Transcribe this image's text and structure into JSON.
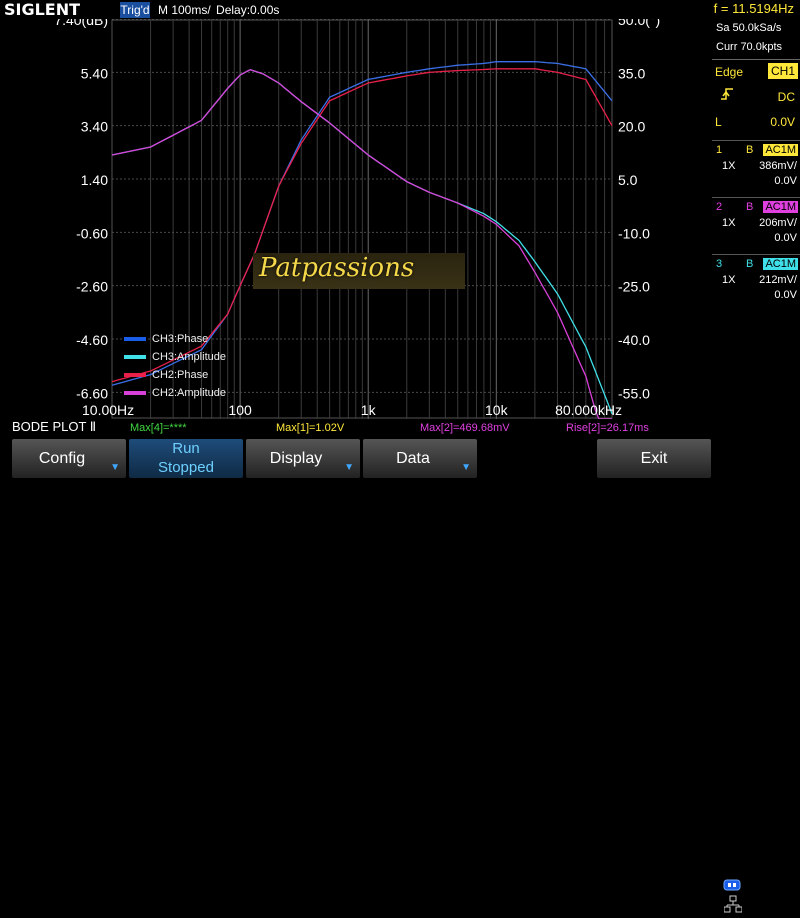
{
  "header": {
    "logo": "SIGLENT",
    "trigger_status": "Trig'd",
    "timebase": "M 100ms/",
    "delay": "Delay:0.00s",
    "frequency": "f = 11.5194Hz"
  },
  "side_panel": {
    "sample_rate": "Sa 50.0kSa/s",
    "memory": "Curr 70.0kpts",
    "trigger_type": "Edge",
    "trigger_source": "CH1",
    "coupling": "DC",
    "level_label": "L",
    "level_value": "0.0V",
    "channels": [
      {
        "num": "1",
        "bw": "B",
        "coupling": "AC1M",
        "probe": "1X",
        "scale": "386mV/",
        "offset": "0.0V",
        "color": "#ffe83a"
      },
      {
        "num": "2",
        "bw": "B",
        "coupling": "AC1M",
        "probe": "1X",
        "scale": "206mV/",
        "offset": "0.0V",
        "color": "#e040e0"
      },
      {
        "num": "3",
        "bw": "B",
        "coupling": "AC1M",
        "probe": "1X",
        "scale": "212mV/",
        "offset": "0.0V",
        "color": "#40e0e8"
      }
    ]
  },
  "status_bar": {
    "mode": "BODE PLOT Ⅱ",
    "meas4": "Max[4]=****",
    "meas1": "Max[1]=1.02V",
    "meas2": "Max[2]=469.68mV",
    "rise2": "Rise[2]=26.17ms"
  },
  "softkeys": {
    "config": "Config",
    "run_line1": "Run",
    "run_line2": "Stopped",
    "display": "Display",
    "data": "Data",
    "exit": "Exit"
  },
  "watermark": "Patpassions",
  "colors": {
    "ch3_phase": "#3a6fe8",
    "ch3_amplitude": "#40e0e8",
    "ch2_phase": "#e8204a",
    "ch2_amplitude": "#d840d8"
  },
  "chart_data": {
    "type": "line",
    "title": "",
    "x_scale": "log",
    "xlim": [
      10,
      80000
    ],
    "x_ticks": [
      "10.00Hz",
      "100",
      "1k",
      "10k",
      "80.000kHz"
    ],
    "left_axis": {
      "label": "(dB)",
      "ylim": [
        -7.6,
        7.4
      ],
      "ticks": [
        "7.40(dB)",
        "5.40",
        "3.40",
        "1.40",
        "-0.60",
        "-2.60",
        "-4.60",
        "-6.60"
      ]
    },
    "right_axis": {
      "label": "(°)",
      "ylim": [
        -62.5,
        50
      ],
      "ticks": [
        "50.0(°)",
        "35.0",
        "20.0",
        "5.0",
        "-10.0",
        "-25.0",
        "-40.0",
        "-55.0"
      ]
    },
    "series": [
      {
        "name": "CH3:Phase",
        "axis": "right",
        "x": [
          10,
          20,
          50,
          80,
          100,
          130,
          200,
          300,
          500,
          1000,
          2000,
          3000,
          5000,
          8000,
          10000,
          15000,
          20000,
          30000,
          50000,
          80000
        ],
        "y": [
          -53,
          -50,
          -43,
          -33,
          -25,
          -16,
          3,
          16,
          28,
          33,
          35,
          36,
          37,
          37.5,
          38,
          38,
          38,
          37.5,
          36,
          27
        ]
      },
      {
        "name": "CH3:Amplitude",
        "axis": "left",
        "x": [
          10,
          20,
          50,
          80,
          100,
          120,
          150,
          200,
          300,
          500,
          1000,
          2000,
          3000,
          5000,
          8000,
          10000,
          15000,
          20000,
          30000,
          50000,
          80000
        ],
        "y": [
          2.3,
          2.6,
          3.6,
          4.8,
          5.3,
          5.5,
          5.35,
          5.0,
          4.3,
          3.5,
          2.3,
          1.3,
          0.9,
          0.5,
          0.1,
          -0.2,
          -0.9,
          -1.7,
          -2.9,
          -4.9,
          -7.4
        ]
      },
      {
        "name": "CH2:Phase",
        "axis": "right",
        "x": [
          10,
          20,
          50,
          80,
          100,
          130,
          200,
          300,
          500,
          1000,
          2000,
          3000,
          5000,
          8000,
          10000,
          15000,
          20000,
          30000,
          50000,
          80000
        ],
        "y": [
          -52,
          -49,
          -42,
          -33,
          -25,
          -16,
          3,
          15,
          27,
          32,
          34,
          35,
          35.5,
          35.8,
          36,
          36,
          36,
          35,
          33,
          20
        ]
      },
      {
        "name": "CH2:Amplitude",
        "axis": "left",
        "x": [
          10,
          20,
          50,
          80,
          100,
          120,
          150,
          200,
          300,
          500,
          1000,
          2000,
          3000,
          5000,
          8000,
          10000,
          15000,
          20000,
          30000,
          50000,
          80000
        ],
        "y": [
          2.3,
          2.6,
          3.6,
          4.8,
          5.3,
          5.5,
          5.35,
          5.0,
          4.3,
          3.5,
          2.3,
          1.3,
          0.9,
          0.5,
          0.0,
          -0.3,
          -1.1,
          -2.1,
          -3.6,
          -6.0,
          -9.5
        ]
      }
    ],
    "grid": true,
    "legend_position": "bottom-left"
  }
}
